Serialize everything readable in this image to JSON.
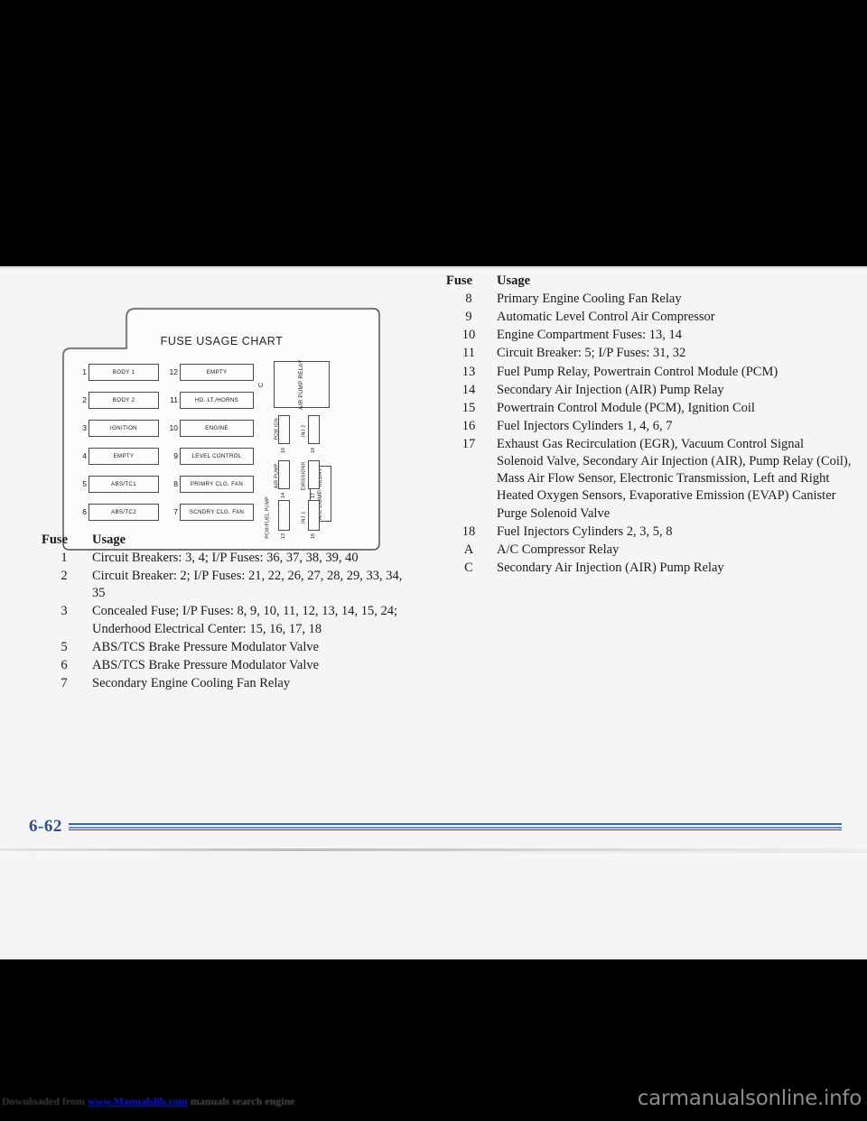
{
  "page": {
    "number": "6-62"
  },
  "diagram": {
    "title": "FUSE USAGE CHART",
    "column_a": [
      {
        "num": "1",
        "label": "BODY 1"
      },
      {
        "num": "2",
        "label": "BODY 2"
      },
      {
        "num": "3",
        "label": "IGNITION"
      },
      {
        "num": "4",
        "label": "EMPTY"
      },
      {
        "num": "5",
        "label": "ABS/TC1"
      },
      {
        "num": "6",
        "label": "ABS/TC2"
      }
    ],
    "column_b": [
      {
        "num": "12",
        "label": "EMPTY"
      },
      {
        "num": "11",
        "label": "HD. LT./HORNS"
      },
      {
        "num": "10",
        "label": "ENGINE"
      },
      {
        "num": "9",
        "label": "LEVEL CONTROL"
      },
      {
        "num": "8",
        "label": "PRIMRY CLG. FAN"
      },
      {
        "num": "7",
        "label": "SCNDRY CLG. FAN"
      }
    ],
    "relays": [
      {
        "id": "C",
        "label": "AIR PUMP RELAY",
        "letter": "C"
      },
      {
        "id": "A",
        "label": "A/C COMP. RELAY",
        "letter": "A"
      }
    ],
    "mini_fuses": [
      {
        "num": "15",
        "label": "PCM IGN"
      },
      {
        "num": "18",
        "label": "INJ 2"
      },
      {
        "num": "14",
        "label": "AIR PUMP"
      },
      {
        "num": "17",
        "label": "EMISSIONS"
      },
      {
        "num": "13",
        "label": "PCM/FUEL PUMP"
      },
      {
        "num": "16",
        "label": "INJ 1"
      }
    ]
  },
  "left_table": {
    "header": {
      "fuse": "Fuse",
      "usage": "Usage"
    },
    "rows": [
      {
        "fuse": "1",
        "usage": "Circuit Breakers: 3, 4; I/P Fuses: 36, 37, 38, 39, 40"
      },
      {
        "fuse": "2",
        "usage": "Circuit Breaker: 2; I/P Fuses: 21, 22, 26, 27, 28, 29, 33, 34, 35"
      },
      {
        "fuse": "3",
        "usage": "Concealed Fuse; I/P Fuses: 8, 9, 10, 11, 12, 13, 14, 15, 24; Underhood Electrical Center: 15, 16, 17, 18"
      },
      {
        "fuse": "5",
        "usage": "ABS/TCS Brake Pressure Modulator Valve"
      },
      {
        "fuse": "6",
        "usage": "ABS/TCS Brake Pressure Modulator Valve"
      },
      {
        "fuse": "7",
        "usage": "Secondary Engine Cooling Fan Relay"
      }
    ]
  },
  "right_table": {
    "header": {
      "fuse": "Fuse",
      "usage": "Usage"
    },
    "rows": [
      {
        "fuse": "8",
        "usage": "Primary Engine Cooling Fan Relay"
      },
      {
        "fuse": "9",
        "usage": "Automatic Level Control Air Compressor"
      },
      {
        "fuse": "10",
        "usage": "Engine Compartment Fuses: 13, 14"
      },
      {
        "fuse": "11",
        "usage": "Circuit Breaker: 5; I/P Fuses: 31, 32"
      },
      {
        "fuse": "13",
        "usage": "Fuel Pump Relay, Powertrain Control Module (PCM)"
      },
      {
        "fuse": "14",
        "usage": "Secondary Air Injection (AIR) Pump Relay"
      },
      {
        "fuse": "15",
        "usage": "Powertrain Control Module (PCM), Ignition Coil"
      },
      {
        "fuse": "16",
        "usage": "Fuel Injectors Cylinders 1, 4, 6, 7"
      },
      {
        "fuse": "17",
        "usage": "Exhaust Gas Recirculation (EGR), Vacuum Control Signal Solenoid Valve, Secondary Air Injection (AIR), Pump Relay (Coil), Mass Air Flow Sensor, Electronic Transmission, Left and Right Heated Oxygen Sensors, Evaporative Emission (EVAP) Canister Purge Solenoid Valve"
      },
      {
        "fuse": "18",
        "usage": "Fuel Injectors Cylinders 2, 3, 5, 8"
      },
      {
        "fuse": "A",
        "usage": "A/C Compressor Relay"
      },
      {
        "fuse": "C",
        "usage": "Secondary Air Injection (AIR) Pump Relay"
      }
    ]
  },
  "watermark": {
    "download_prefix": "Downloaded from ",
    "download_link": "www.Manualslib.com",
    "download_suffix": " manuals search engine",
    "site": "carmanualsonline.info"
  },
  "colors": {
    "page_number": "#2d4f91",
    "rule_primary": "#3a66ad",
    "rule_secondary": "#6e8fc4",
    "link": "#0b16e8"
  }
}
